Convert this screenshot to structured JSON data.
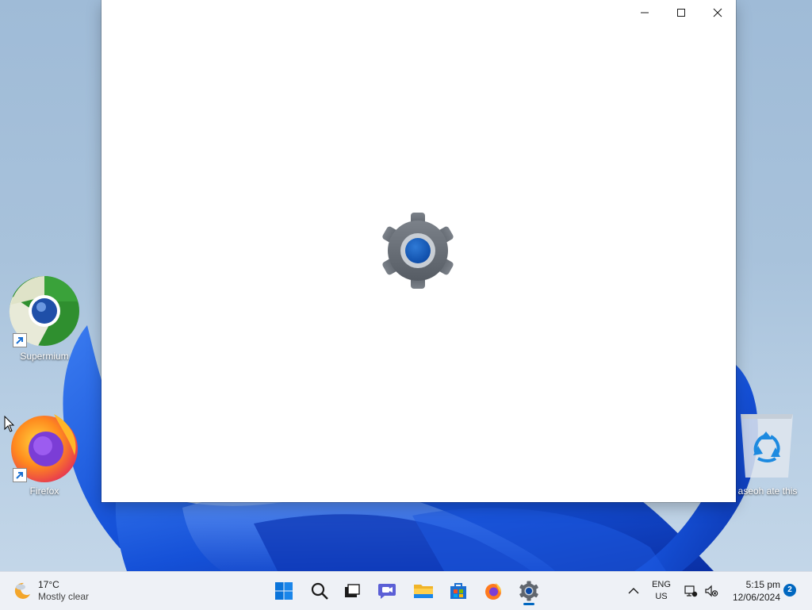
{
  "desktop": {
    "icons": [
      {
        "label": "Supermium",
        "icon": "supermium-icon"
      },
      {
        "label": "Firefox",
        "icon": "firefox-icon"
      },
      {
        "label": "aseoh ate this",
        "icon": "recycle-bin-icon"
      }
    ]
  },
  "window": {
    "buttons": {
      "minimize": "minimize-icon",
      "maximize": "maximize-icon",
      "close": "close-icon"
    },
    "splash_icon": "settings-gear-icon"
  },
  "taskbar": {
    "weather": {
      "temperature": "17°C",
      "condition": "Mostly clear",
      "icon": "moon-cloud-icon"
    },
    "apps": [
      {
        "name": "Start",
        "icon": "windows-start-icon"
      },
      {
        "name": "Search",
        "icon": "search-icon"
      },
      {
        "name": "Task View",
        "icon": "task-view-icon"
      },
      {
        "name": "Chat",
        "icon": "teams-chat-icon"
      },
      {
        "name": "File Explorer",
        "icon": "folder-icon"
      },
      {
        "name": "Microsoft Store",
        "icon": "store-icon"
      },
      {
        "name": "Firefox",
        "icon": "firefox-icon"
      },
      {
        "name": "Settings",
        "icon": "settings-gear-icon",
        "active": true
      }
    ],
    "tray": {
      "language_line1": "ENG",
      "language_line2": "US",
      "time": "5:15 pm",
      "date": "12/06/2024",
      "notification_count": "2"
    }
  }
}
